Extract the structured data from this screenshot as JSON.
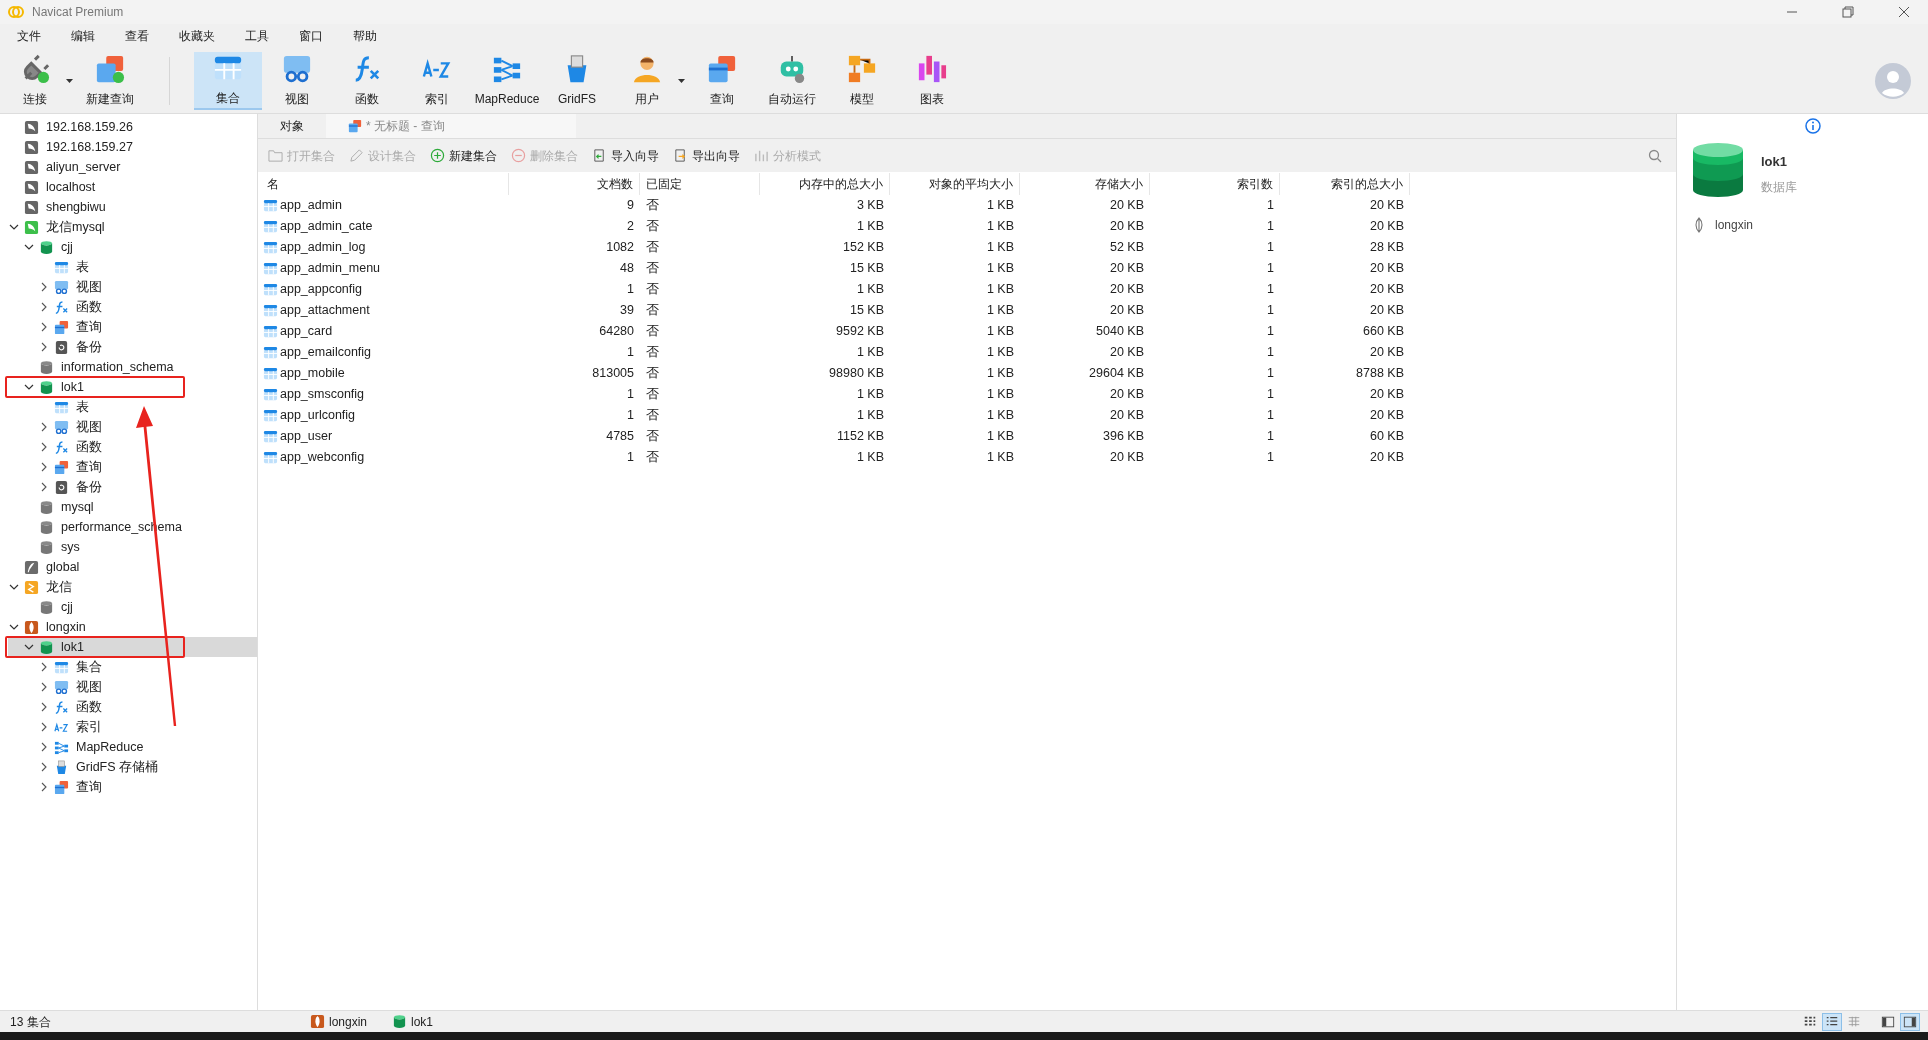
{
  "window": {
    "title": "Navicat Premium"
  },
  "menu": [
    "文件",
    "编辑",
    "查看",
    "收藏夹",
    "工具",
    "窗口",
    "帮助"
  ],
  "toolbar": [
    {
      "label": "连接",
      "kind": "connect",
      "selected": false,
      "dropdown": true
    },
    {
      "label": "新建查询",
      "kind": "newquery",
      "selected": false,
      "dropdown": false
    },
    {
      "label": "集合",
      "kind": "collection",
      "selected": true,
      "dropdown": false
    },
    {
      "label": "视图",
      "kind": "view",
      "selected": false,
      "dropdown": false
    },
    {
      "label": "函数",
      "kind": "function",
      "selected": false,
      "dropdown": false
    },
    {
      "label": "索引",
      "kind": "index",
      "selected": false,
      "dropdown": false
    },
    {
      "label": "MapReduce",
      "kind": "mapreduce",
      "selected": false,
      "dropdown": false
    },
    {
      "label": "GridFS",
      "kind": "gridfs",
      "selected": false,
      "dropdown": false
    },
    {
      "label": "用户",
      "kind": "user",
      "selected": false,
      "dropdown": true
    },
    {
      "label": "查询",
      "kind": "query",
      "selected": false,
      "dropdown": false
    },
    {
      "label": "自动运行",
      "kind": "robot",
      "selected": false,
      "dropdown": false
    },
    {
      "label": "模型",
      "kind": "model",
      "selected": false,
      "dropdown": false
    },
    {
      "label": "图表",
      "kind": "chart",
      "selected": false,
      "dropdown": false
    }
  ],
  "tree": [
    {
      "label": "192.168.159.26",
      "kind": "mysql",
      "selected": false
    },
    {
      "label": "192.168.159.27",
      "kind": "mysql",
      "selected": false
    },
    {
      "label": "aliyun_server",
      "kind": "mysql",
      "selected": false
    },
    {
      "label": "localhost",
      "kind": "mysql",
      "selected": false
    },
    {
      "label": "shengbiwu",
      "kind": "mysql",
      "selected": false
    },
    {
      "label": "龙信mysql",
      "kind": "mysql-on",
      "selected": false,
      "expanded": true,
      "children": [
        {
          "label": "cjj",
          "kind": "db-on",
          "selected": false,
          "expanded": true,
          "children": [
            {
              "label": "表",
              "kind": "table",
              "selected": false
            },
            {
              "label": "视图",
              "kind": "view",
              "selected": false,
              "expanded": false
            },
            {
              "label": "函数",
              "kind": "function",
              "selected": false,
              "expanded": false
            },
            {
              "label": "查询",
              "kind": "query",
              "selected": false,
              "expanded": false
            },
            {
              "label": "备份",
              "kind": "backup",
              "selected": false,
              "expanded": false
            }
          ]
        },
        {
          "label": "information_schema",
          "kind": "db",
          "selected": false
        },
        {
          "label": "lok1",
          "kind": "db-on",
          "selected": false,
          "annotated": true,
          "expanded": true,
          "children": [
            {
              "label": "表",
              "kind": "table",
              "selected": false
            },
            {
              "label": "视图",
              "kind": "view",
              "selected": false,
              "expanded": false
            },
            {
              "label": "函数",
              "kind": "function",
              "selected": false,
              "expanded": false
            },
            {
              "label": "查询",
              "kind": "query",
              "selected": false,
              "expanded": false
            },
            {
              "label": "备份",
              "kind": "backup",
              "selected": false,
              "expanded": false
            }
          ]
        },
        {
          "label": "mysql",
          "kind": "db",
          "selected": false
        },
        {
          "label": "performance_schema",
          "kind": "db",
          "selected": false
        },
        {
          "label": "sys",
          "kind": "db",
          "selected": false
        }
      ]
    },
    {
      "label": "global",
      "kind": "feather",
      "selected": false
    },
    {
      "label": "龙信",
      "kind": "redis",
      "selected": false,
      "expanded": true,
      "children": [
        {
          "label": "cjj",
          "kind": "db",
          "selected": false
        }
      ]
    },
    {
      "label": "longxin",
      "kind": "mongo",
      "selected": false,
      "expanded": true,
      "children": [
        {
          "label": "lok1",
          "kind": "db-on",
          "selected": true,
          "annotated": true,
          "expanded": true,
          "children": [
            {
              "label": "集合",
              "kind": "table",
              "selected": false,
              "expanded": false
            },
            {
              "label": "视图",
              "kind": "view",
              "selected": false,
              "expanded": false
            },
            {
              "label": "函数",
              "kind": "function",
              "selected": false,
              "expanded": false
            },
            {
              "label": "索引",
              "kind": "index",
              "selected": false,
              "expanded": false
            },
            {
              "label": "MapReduce",
              "kind": "mapreduce",
              "selected": false,
              "expanded": false
            },
            {
              "label": "GridFS 存储桶",
              "kind": "gridfs",
              "selected": false,
              "expanded": false
            },
            {
              "label": "查询",
              "kind": "query",
              "selected": false,
              "expanded": false
            }
          ]
        }
      ]
    }
  ],
  "tabs": [
    {
      "label": "对象",
      "kind": "plain",
      "selected": true
    },
    {
      "label": "* 无标题 - 查询",
      "kind": "query",
      "selected": false
    }
  ],
  "actions": [
    {
      "label": "打开集合",
      "kind": "open",
      "disabled": true
    },
    {
      "label": "设计集合",
      "kind": "design",
      "disabled": true
    },
    {
      "label": "新建集合",
      "kind": "add",
      "disabled": false
    },
    {
      "label": "删除集合",
      "kind": "remove",
      "disabled": true
    },
    {
      "label": "导入向导",
      "kind": "import",
      "disabled": false
    },
    {
      "label": "导出向导",
      "kind": "export",
      "disabled": false
    },
    {
      "label": "分析模式",
      "kind": "analyze",
      "disabled": true
    }
  ],
  "table": {
    "columns": [
      "名",
      "文档数",
      "已固定",
      "内存中的总大小",
      "对象的平均大小",
      "存储大小",
      "索引数",
      "索引的总大小"
    ],
    "rows": [
      [
        "app_admin",
        "9",
        "否",
        "3 KB",
        "1 KB",
        "20 KB",
        "1",
        "20 KB"
      ],
      [
        "app_admin_cate",
        "2",
        "否",
        "1 KB",
        "1 KB",
        "20 KB",
        "1",
        "20 KB"
      ],
      [
        "app_admin_log",
        "1082",
        "否",
        "152 KB",
        "1 KB",
        "52 KB",
        "1",
        "28 KB"
      ],
      [
        "app_admin_menu",
        "48",
        "否",
        "15 KB",
        "1 KB",
        "20 KB",
        "1",
        "20 KB"
      ],
      [
        "app_appconfig",
        "1",
        "否",
        "1 KB",
        "1 KB",
        "20 KB",
        "1",
        "20 KB"
      ],
      [
        "app_attachment",
        "39",
        "否",
        "15 KB",
        "1 KB",
        "20 KB",
        "1",
        "20 KB"
      ],
      [
        "app_card",
        "64280",
        "否",
        "9592 KB",
        "1 KB",
        "5040 KB",
        "1",
        "660 KB"
      ],
      [
        "app_emailconfig",
        "1",
        "否",
        "1 KB",
        "1 KB",
        "20 KB",
        "1",
        "20 KB"
      ],
      [
        "app_mobile",
        "813005",
        "否",
        "98980 KB",
        "1 KB",
        "29604 KB",
        "1",
        "8788 KB"
      ],
      [
        "app_smsconfig",
        "1",
        "否",
        "1 KB",
        "1 KB",
        "20 KB",
        "1",
        "20 KB"
      ],
      [
        "app_urlconfig",
        "1",
        "否",
        "1 KB",
        "1 KB",
        "20 KB",
        "1",
        "20 KB"
      ],
      [
        "app_user",
        "4785",
        "否",
        "1152 KB",
        "1 KB",
        "396 KB",
        "1",
        "60 KB"
      ],
      [
        "app_webconfig",
        "1",
        "否",
        "1 KB",
        "1 KB",
        "20 KB",
        "1",
        "20 KB"
      ]
    ]
  },
  "info_panel": {
    "name": "lok1",
    "type": "数据库",
    "connection": "longxin"
  },
  "status_bar": {
    "count": "13 集合",
    "connection": "longxin",
    "database": "lok1",
    "views": [
      {
        "kind": "grid",
        "selected": false
      },
      {
        "kind": "list",
        "selected": true
      },
      {
        "kind": "detail",
        "selected": false
      }
    ],
    "panels": [
      {
        "kind": "left",
        "selected": false
      },
      {
        "kind": "right",
        "selected": true
      }
    ]
  }
}
